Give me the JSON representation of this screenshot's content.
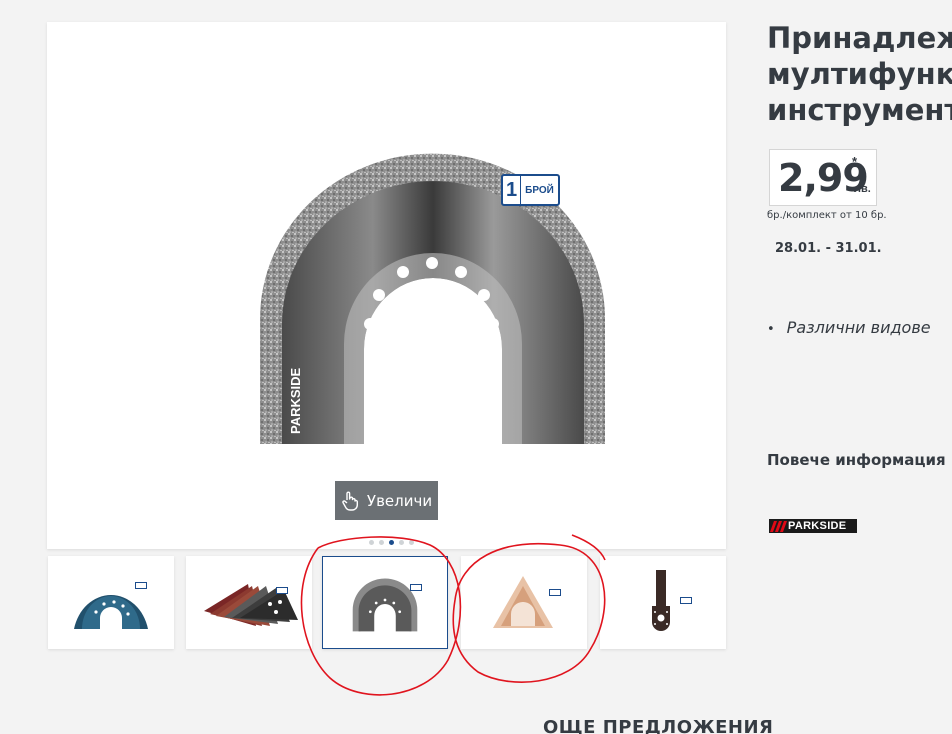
{
  "product": {
    "title_lines": [
      "Принадлежн",
      "мултифункци",
      "инструмент"
    ],
    "price": {
      "value": "2,99",
      "asterisk": "*",
      "currency": "лв.",
      "unit_note": "бр./комплект от 10 бр."
    },
    "dates": "28.01. - 31.01.",
    "features": [
      "Различни видове"
    ],
    "more_info_label": "Повече информация",
    "brand": "PARKSIDE"
  },
  "gallery": {
    "badge": {
      "count": "1",
      "unit": "БРОЙ"
    },
    "blade_brand_text": "PARKSIDE",
    "zoom_label": "Увеличи",
    "dot_count": 5,
    "active_dot": 3,
    "thumbnails": [
      {
        "name": "round-blue-blade",
        "selected": false
      },
      {
        "name": "sanding-sheets",
        "selected": false
      },
      {
        "name": "carbide-rasp-blade",
        "selected": true
      },
      {
        "name": "delta-sanding-pad",
        "selected": false
      },
      {
        "name": "plunge-cut-blade",
        "selected": false
      }
    ]
  },
  "more_offers_heading": "ОЩЕ ПРЕДЛОЖЕНИЯ",
  "colors": {
    "accent": "#1b4c8c",
    "annotation": "#e0141e",
    "brand_red": "#e10915"
  }
}
